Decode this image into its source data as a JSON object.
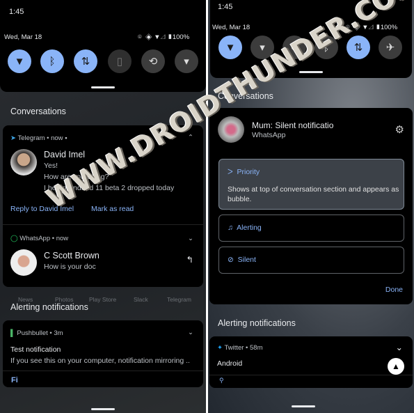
{
  "left": {
    "status": {
      "time": "1:45",
      "date": "Wed, Mar 18",
      "battery": "100%"
    },
    "tiles": [
      {
        "icon": "wifi-icon",
        "state": "on"
      },
      {
        "icon": "bluetooth-icon",
        "state": "on"
      },
      {
        "icon": "data-icon",
        "state": "on"
      },
      {
        "icon": "battery-saver-icon",
        "state": "disabled"
      },
      {
        "icon": "auto-rotate-icon",
        "state": "off"
      },
      {
        "icon": "flashlight-icon",
        "state": "off"
      }
    ],
    "conversations_heading": "Conversations",
    "telegram": {
      "app": "Telegram • now",
      "sender": "David Imel",
      "lines": [
        "Yes!",
        "How are you doing?",
        "I heard Android 11 beta 2 dropped today"
      ],
      "actions": [
        "Reply to David Imel",
        "Mark as read"
      ]
    },
    "whatsapp": {
      "app": "WhatsApp • now",
      "sender": "C Scott Brown",
      "text": "How is your doc"
    },
    "app_labels": [
      "News",
      "Photos",
      "Play Store",
      "Slack",
      "Telegram"
    ],
    "alerting_heading": "Alerting notifications",
    "pushbullet": {
      "app": "Pushbullet • 3m",
      "title": "Test notification",
      "text": "If you see this on your computer, notification mirroring .."
    }
  },
  "right": {
    "status": {
      "time": "1:45",
      "date": "Wed, Mar 18",
      "battery": "100%"
    },
    "tiles": [
      {
        "icon": "wifi-icon",
        "state": "on"
      },
      {
        "icon": "flashlight-icon",
        "state": "off"
      },
      {
        "icon": "location-icon",
        "state": "off"
      },
      {
        "icon": "bluetooth-icon",
        "state": "off"
      },
      {
        "icon": "data-icon",
        "state": "on"
      },
      {
        "icon": "airplane-icon",
        "state": "off"
      }
    ],
    "conversations_heading": "Conversations",
    "dialog": {
      "title": "Mum: Silent notificatio",
      "app": "WhatsApp",
      "options": [
        {
          "label": "Priority",
          "desc": "Shows at top of conversation section and appears as bubble.",
          "selected": true
        },
        {
          "label": "Alerting",
          "selected": false
        },
        {
          "label": "Silent",
          "selected": false
        }
      ],
      "done": "Done"
    },
    "alerting_heading": "Alerting notifications",
    "twitter": {
      "app": "Twitter • 58m",
      "title": "Android"
    }
  },
  "watermark": "WWW.DROIDTHUNDER.COM",
  "colors": {
    "accent": "#8ab4f8",
    "card": "#000000"
  }
}
